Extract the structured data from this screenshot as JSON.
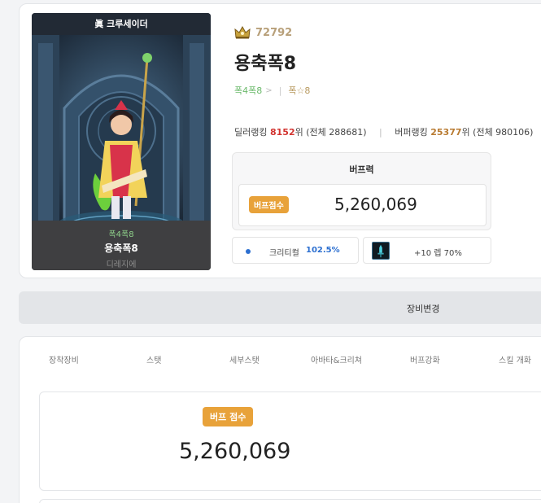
{
  "character": {
    "job": "眞 크루세이더",
    "adventure": "폭4폭8",
    "name": "용축폭8",
    "server": "디레지에"
  },
  "profile": {
    "level": "72792",
    "name": "용축폭8",
    "adventure_tag": "폭4폭8",
    "chevron": ">",
    "separator": "|",
    "guild_tag": "폭☆8"
  },
  "ranking": {
    "dealer_label": "딜러랭킹",
    "dealer_rank": "8152",
    "dealer_unit": "위",
    "dealer_total": "(전체 288681)",
    "divider": "|",
    "buffer_label": "버퍼랭킹",
    "buffer_rank": "25377",
    "buffer_unit": "위",
    "buffer_total": "(전체 980106)"
  },
  "buff_power": {
    "heading": "버프력",
    "badge": "버프점수",
    "value": "5,260,069"
  },
  "stats": {
    "crit_label": "크리티컬",
    "crit_value": "102.5%",
    "item_label": "+10 렙 70%"
  },
  "equip_bar": {
    "label": "장비변경"
  },
  "tabs": [
    {
      "label": "장착장비"
    },
    {
      "label": "스탯"
    },
    {
      "label": "세부스탯"
    },
    {
      "label": "아바타&크리쳐"
    },
    {
      "label": "버프강화"
    },
    {
      "label": "스킬 개화"
    }
  ],
  "buff_score": {
    "badge": "버프 점수",
    "value": "5,260,069"
  },
  "colors": {
    "accent_orange": "#e8a23a",
    "rank_red": "#d2332f",
    "rank_brown": "#b87a30",
    "crit_blue": "#2c6fd0",
    "adventure_green": "#6bb96b"
  },
  "icons": {
    "level": "crown-emblem-icon",
    "item": "sword-item-icon"
  }
}
